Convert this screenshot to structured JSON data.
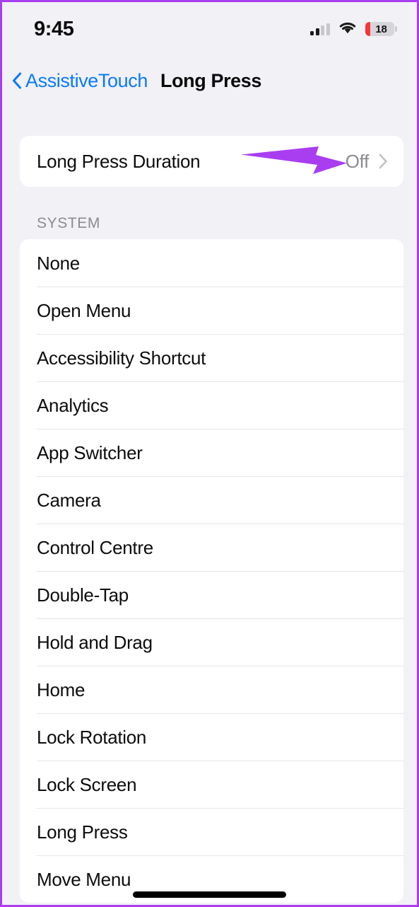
{
  "status_bar": {
    "time": "9:45",
    "signal_icon": "cellular-signal-icon",
    "wifi_icon": "wifi-icon",
    "battery_icon": "battery-icon",
    "battery_percent": "18",
    "battery_level": 18,
    "battery_color": "#f8333c"
  },
  "nav": {
    "back_icon": "chevron-left-icon",
    "back_label": "AssistiveTouch",
    "title": "Long Press",
    "accent_color": "#0A7AFF"
  },
  "duration_row": {
    "label": "Long Press Duration",
    "value": "Off",
    "chevron_icon": "chevron-right-icon"
  },
  "annotation": {
    "type": "arrow",
    "color": "#A93EF0",
    "points_to": "Off"
  },
  "system_section": {
    "header": "SYSTEM",
    "items": [
      {
        "label": "None"
      },
      {
        "label": "Open Menu"
      },
      {
        "label": "Accessibility Shortcut"
      },
      {
        "label": "Analytics"
      },
      {
        "label": "App Switcher"
      },
      {
        "label": "Camera"
      },
      {
        "label": "Control Centre"
      },
      {
        "label": "Double-Tap"
      },
      {
        "label": "Hold and Drag"
      },
      {
        "label": "Home"
      },
      {
        "label": "Lock Rotation"
      },
      {
        "label": "Lock Screen"
      },
      {
        "label": "Long Press"
      },
      {
        "label": "Move Menu"
      }
    ]
  },
  "home_indicator": {
    "name": "home-indicator"
  },
  "theme": {
    "background": "#F2F1F6",
    "card": "#FFFFFF",
    "separator": "#E6E6E8",
    "secondary_text": "#8B8B90",
    "frame_border": "#A93EF0"
  }
}
